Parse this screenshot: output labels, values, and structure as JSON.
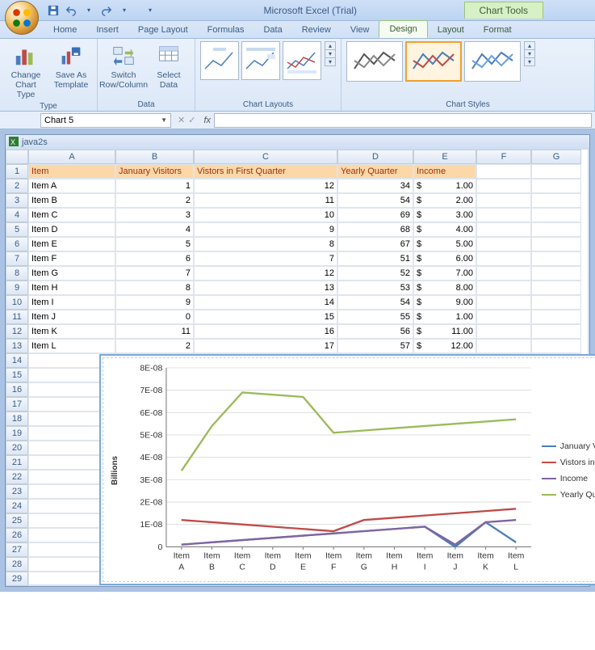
{
  "app": {
    "title": "Microsoft Excel (Trial)",
    "chart_tools": "Chart Tools"
  },
  "tabs": {
    "home": "Home",
    "insert": "Insert",
    "page_layout": "Page Layout",
    "formulas": "Formulas",
    "data": "Data",
    "review": "Review",
    "view": "View",
    "design": "Design",
    "layout": "Layout",
    "format": "Format"
  },
  "ribbon": {
    "type": {
      "label": "Type",
      "change": "Change Chart Type",
      "save_template": "Save As Template"
    },
    "data_group": {
      "label": "Data",
      "switch": "Switch Row/Column",
      "select": "Select Data"
    },
    "layouts": {
      "label": "Chart Layouts"
    },
    "styles": {
      "label": "Chart Styles"
    }
  },
  "namebox": "Chart 5",
  "workbook": "java2s",
  "columns": [
    "A",
    "B",
    "C",
    "D",
    "E",
    "F",
    "G"
  ],
  "headers": {
    "item": "Item",
    "jan": "January Visitors",
    "q1": "Vistors in First Quarter",
    "yq": "Yearly Quarter",
    "inc": "Income"
  },
  "rows": [
    {
      "n": 1,
      "item": "Item A",
      "jan": "1",
      "q1": "12",
      "yq": "34",
      "inc": "1.00"
    },
    {
      "n": 2,
      "item": "Item B",
      "jan": "2",
      "q1": "11",
      "yq": "54",
      "inc": "2.00"
    },
    {
      "n": 3,
      "item": "Item C",
      "jan": "3",
      "q1": "10",
      "yq": "69",
      "inc": "3.00"
    },
    {
      "n": 4,
      "item": "Item D",
      "jan": "4",
      "q1": "9",
      "yq": "68",
      "inc": "4.00"
    },
    {
      "n": 5,
      "item": "Item E",
      "jan": "5",
      "q1": "8",
      "yq": "67",
      "inc": "5.00"
    },
    {
      "n": 6,
      "item": "Item F",
      "jan": "6",
      "q1": "7",
      "yq": "51",
      "inc": "6.00"
    },
    {
      "n": 7,
      "item": "Item G",
      "jan": "7",
      "q1": "12",
      "yq": "52",
      "inc": "7.00"
    },
    {
      "n": 8,
      "item": "Item H",
      "jan": "8",
      "q1": "13",
      "yq": "53",
      "inc": "8.00"
    },
    {
      "n": 9,
      "item": "Item I",
      "jan": "9",
      "q1": "14",
      "yq": "54",
      "inc": "9.00"
    },
    {
      "n": 10,
      "item": "Item J",
      "jan": "0",
      "q1": "15",
      "yq": "55",
      "inc": "1.00"
    },
    {
      "n": 11,
      "item": "Item K",
      "jan": "11",
      "q1": "16",
      "yq": "56",
      "inc": "11.00"
    },
    {
      "n": 12,
      "item": "Item L",
      "jan": "2",
      "q1": "17",
      "yq": "57",
      "inc": "12.00"
    }
  ],
  "currency": "$",
  "chart_data": {
    "type": "line",
    "ylabel": "Billions",
    "ylim": [
      0,
      8e-08
    ],
    "yticks": [
      "0",
      "1E-08",
      "2E-08",
      "3E-08",
      "4E-08",
      "5E-08",
      "6E-08",
      "7E-08",
      "8E-08"
    ],
    "categories": [
      "Item A",
      "Item B",
      "Item C",
      "Item D",
      "Item E",
      "Item F",
      "Item G",
      "Item H",
      "Item I",
      "Item J",
      "Item K",
      "Item L"
    ],
    "series": [
      {
        "name": "January Visitors",
        "color": "#4a7ebb",
        "values": [
          1,
          2,
          3,
          4,
          5,
          6,
          7,
          8,
          9,
          0,
          11,
          2
        ]
      },
      {
        "name": "Vistors in First Quarter",
        "color": "#be4b48",
        "values": [
          12,
          11,
          10,
          9,
          8,
          7,
          12,
          13,
          14,
          15,
          16,
          17
        ]
      },
      {
        "name": "Income",
        "color": "#8064a2",
        "values": [
          1,
          2,
          3,
          4,
          5,
          6,
          7,
          8,
          9,
          1,
          11,
          12
        ]
      },
      {
        "name": "Yearly Quarter",
        "color": "#9bbb59",
        "values": [
          34,
          54,
          69,
          68,
          67,
          51,
          52,
          53,
          54,
          55,
          56,
          57
        ]
      }
    ],
    "legend_position": "right",
    "data_scale_note": "values plotted after ×1e-9 to match 'Billions' axis"
  }
}
